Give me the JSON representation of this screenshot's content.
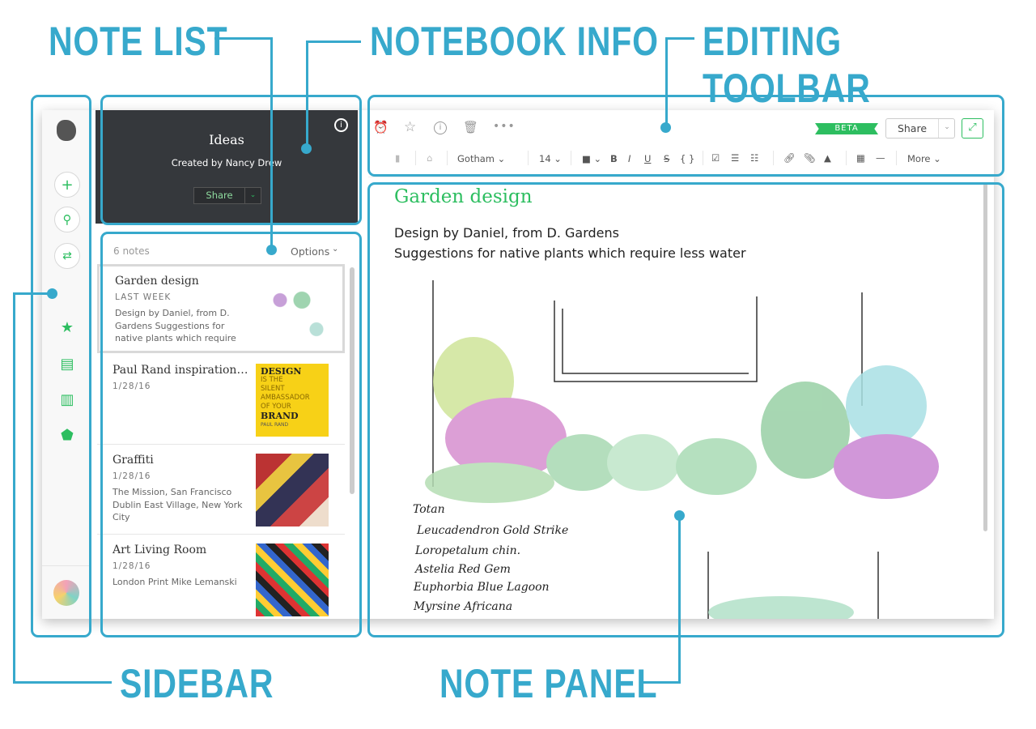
{
  "annotations": {
    "note_list": "NOTE LIST",
    "notebook_info": "NOTEBOOK INFO",
    "editing_toolbar": "EDITING TOOLBAR",
    "sidebar": "SIDEBAR",
    "note_panel": "NOTE PANEL",
    "color": "#37a9cc"
  },
  "notebook": {
    "name": "Ideas",
    "created_by": "Created by Nancy Drew",
    "share": "Share"
  },
  "note_list": {
    "count": "6 notes",
    "options": "Options",
    "notes": [
      {
        "title": "Garden design",
        "date": "LAST WEEK",
        "snippet": "Design by Daniel, from D. Gardens  Suggestions for native plants which require"
      },
      {
        "title": "Paul Rand inspirational...",
        "date": "1/28/16",
        "snippet": ""
      },
      {
        "title": "Graffiti",
        "date": "1/28/16",
        "snippet": "The Mission, San Francisco Dublin East Village, New York City"
      },
      {
        "title": "Art Living Room",
        "date": "1/28/16",
        "snippet": "London Print Mike Lemanski"
      }
    ]
  },
  "poster": {
    "l1": "DESIGN",
    "l2": "IS THE",
    "l3": "SILENT",
    "l4": "AMBASSADOR",
    "l5": "OF YOUR",
    "l6": "BRAND",
    "l7": "PAUL RAND"
  },
  "toolbar": {
    "beta": "BETA",
    "share": "Share",
    "font": "Gotham",
    "size": "14",
    "more": "More",
    "bold": "B",
    "italic": "I",
    "underline": "U",
    "strike": "S",
    "code": "{ }"
  },
  "note": {
    "title": "Garden design",
    "line1": "Design by Daniel, from D. Gardens",
    "line2": "Suggestions for native plants which require less water",
    "sketch_labels": [
      "Totan",
      "Leucadendron Gold Strike",
      "Loropetalum chin.",
      "Astelia Red Gem",
      "Euphorbia Blue Lagoon",
      "Myrsine Africana"
    ]
  },
  "colors": {
    "accent": "#2dbe60",
    "dark": "#35383c",
    "poster": "#f7d117"
  }
}
